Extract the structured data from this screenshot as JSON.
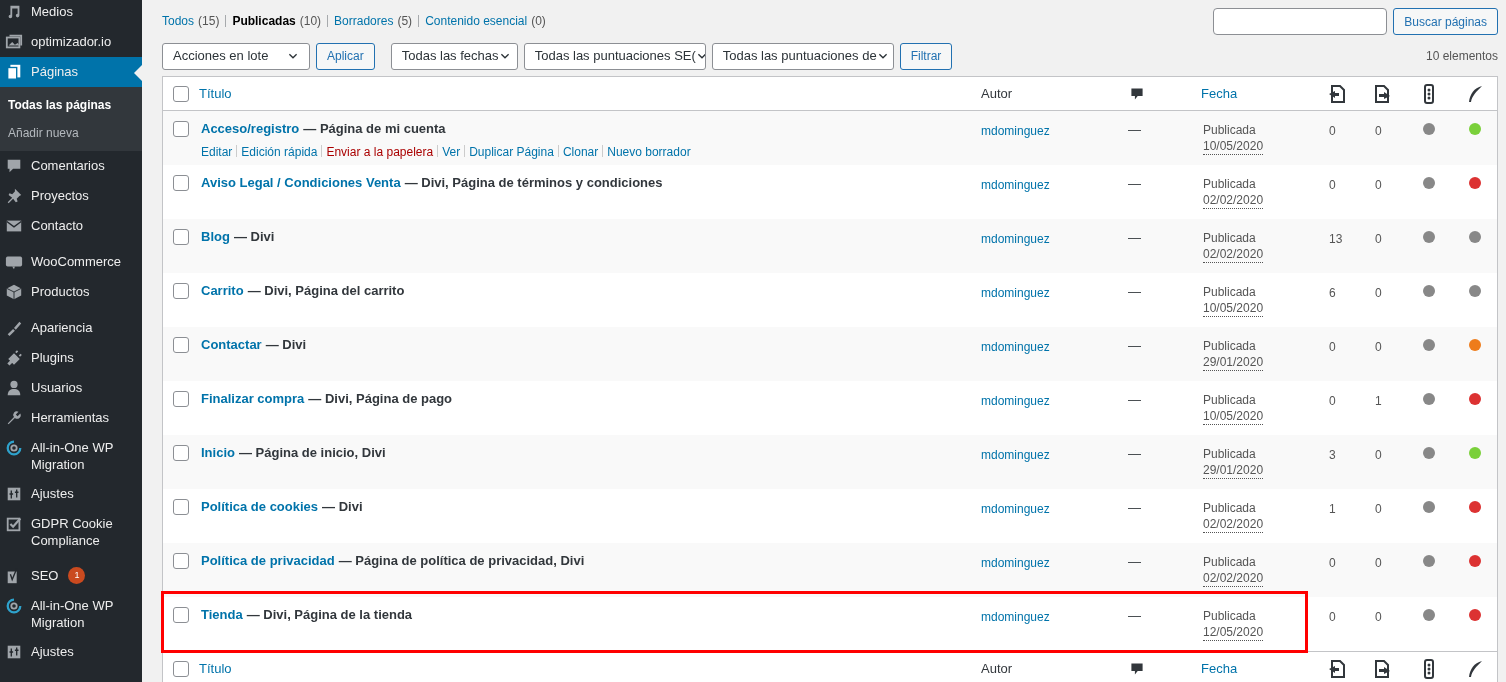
{
  "sidebar": {
    "items": [
      {
        "kind": "media",
        "label": "Medios",
        "selected": false
      },
      {
        "kind": "image",
        "label": "optimizador.io",
        "selected": false
      },
      {
        "kind": "pages",
        "label": "Páginas",
        "selected": true,
        "children": [
          {
            "label": "Todas las páginas",
            "selected": true
          },
          {
            "label": "Añadir nueva",
            "selected": false
          }
        ]
      },
      {
        "kind": "comment",
        "label": "Comentarios",
        "selected": false
      },
      {
        "kind": "pin",
        "label": "Proyectos",
        "selected": false
      },
      {
        "kind": "mail",
        "label": "Contacto",
        "selected": false
      },
      {
        "kind": "woo",
        "label": "WooCommerce",
        "selected": false
      },
      {
        "kind": "box",
        "label": "Productos",
        "selected": false
      },
      {
        "kind": "brush",
        "label": "Apariencia",
        "selected": false
      },
      {
        "kind": "plug",
        "label": "Plugins",
        "selected": false
      },
      {
        "kind": "user",
        "label": "Usuarios",
        "selected": false
      },
      {
        "kind": "wrench",
        "label": "Herramientas",
        "selected": false
      },
      {
        "kind": "migrate",
        "label": "All-in-One WP Migration",
        "selected": false
      },
      {
        "kind": "sliders",
        "label": "Ajustes",
        "selected": false
      },
      {
        "kind": "check",
        "label": "GDPR Cookie Compliance",
        "selected": false
      },
      {
        "kind": "yoast",
        "label": "SEO",
        "selected": false,
        "badge": "1"
      },
      {
        "kind": "migrate",
        "label": "All-in-One WP Migration",
        "selected": false
      },
      {
        "kind": "sliders",
        "label": "Ajustes",
        "selected": false
      }
    ]
  },
  "filters": [
    {
      "label": "Todos",
      "count": "(15)",
      "selected": false
    },
    {
      "label": "Publicadas",
      "count": "(10)",
      "selected": true
    },
    {
      "label": "Borradores",
      "count": "(5)",
      "selected": false
    },
    {
      "label": "Contenido esencial",
      "count": "(0)",
      "selected": false
    }
  ],
  "search": {
    "button": "Buscar páginas"
  },
  "bulk": {
    "select": "Acciones en lote",
    "apply": "Aplicar"
  },
  "dropdowns": [
    "Todas las fechas",
    "Todas las puntuaciones SE(",
    "Todas las puntuaciones de"
  ],
  "filter_button": "Filtrar",
  "count": "10 elementos",
  "header": {
    "checked": false,
    "title": "Título",
    "author": "Autor",
    "date": "Fecha"
  },
  "rows": [
    {
      "checked": false,
      "title": "Acceso/registro",
      "states": "— Página de mi cuenta",
      "author": "mdominguez",
      "comments": "—",
      "status": "Publicada",
      "date": "10/05/2020",
      "links_in": "0",
      "links_out": "0",
      "seo": {
        "color": "#888888"
      },
      "readability": {
        "color": "#7ad03a"
      },
      "highlighted": false,
      "actions": [
        {
          "label": "Editar",
          "kind": "link"
        },
        {
          "label": "Edición rápida",
          "kind": "link"
        },
        {
          "label": "Enviar a la papelera",
          "kind": "delete"
        },
        {
          "label": "Ver",
          "kind": "link"
        },
        {
          "label": "Duplicar Página",
          "kind": "link"
        },
        {
          "label": "Clonar",
          "kind": "link"
        },
        {
          "label": "Nuevo borrador",
          "kind": "link"
        }
      ]
    },
    {
      "checked": false,
      "title": "Aviso Legal / Condiciones Venta",
      "states": "— Divi, Página de términos y condiciones",
      "author": "mdominguez",
      "comments": "—",
      "status": "Publicada",
      "date": "02/02/2020",
      "links_in": "0",
      "links_out": "0",
      "seo": {
        "color": "#888888"
      },
      "readability": {
        "color": "#dc3232"
      },
      "highlighted": false
    },
    {
      "checked": false,
      "title": "Blog",
      "states": "— Divi",
      "author": "mdominguez",
      "comments": "—",
      "status": "Publicada",
      "date": "02/02/2020",
      "links_in": "13",
      "links_out": "0",
      "seo": {
        "color": "#888888"
      },
      "readability": {
        "color": "#888888"
      },
      "highlighted": false
    },
    {
      "checked": false,
      "title": "Carrito",
      "states": "— Divi, Página del carrito",
      "author": "mdominguez",
      "comments": "—",
      "status": "Publicada",
      "date": "10/05/2020",
      "links_in": "6",
      "links_out": "0",
      "seo": {
        "color": "#888888"
      },
      "readability": {
        "color": "#888888"
      },
      "highlighted": false
    },
    {
      "checked": false,
      "title": "Contactar",
      "states": "— Divi",
      "author": "mdominguez",
      "comments": "—",
      "status": "Publicada",
      "date": "29/01/2020",
      "links_in": "0",
      "links_out": "0",
      "seo": {
        "color": "#888888"
      },
      "readability": {
        "color": "#ee7c1b"
      },
      "highlighted": false
    },
    {
      "checked": false,
      "title": "Finalizar compra",
      "states": "— Divi, Página de pago",
      "author": "mdominguez",
      "comments": "—",
      "status": "Publicada",
      "date": "10/05/2020",
      "links_in": "0",
      "links_out": "1",
      "seo": {
        "color": "#888888"
      },
      "readability": {
        "color": "#dc3232"
      },
      "highlighted": false
    },
    {
      "checked": false,
      "title": "Inicio",
      "states": "— Página de inicio, Divi",
      "author": "mdominguez",
      "comments": "—",
      "status": "Publicada",
      "date": "29/01/2020",
      "links_in": "3",
      "links_out": "0",
      "seo": {
        "color": "#888888"
      },
      "readability": {
        "color": "#7ad03a"
      },
      "highlighted": false
    },
    {
      "checked": false,
      "title": "Política de cookies",
      "states": "— Divi",
      "author": "mdominguez",
      "comments": "—",
      "status": "Publicada",
      "date": "02/02/2020",
      "links_in": "1",
      "links_out": "0",
      "seo": {
        "color": "#888888"
      },
      "readability": {
        "color": "#dc3232"
      },
      "highlighted": false
    },
    {
      "checked": false,
      "title": "Política de privacidad",
      "states": "— Página de política de privacidad, Divi",
      "author": "mdominguez",
      "comments": "—",
      "status": "Publicada",
      "date": "02/02/2020",
      "links_in": "0",
      "links_out": "0",
      "seo": {
        "color": "#888888"
      },
      "readability": {
        "color": "#dc3232"
      },
      "highlighted": false
    },
    {
      "checked": false,
      "title": "Tienda",
      "states": "— Divi, Página de la tienda",
      "author": "mdominguez",
      "comments": "—",
      "status": "Publicada",
      "date": "12/05/2020",
      "links_in": "0",
      "links_out": "0",
      "seo": {
        "color": "#888888"
      },
      "readability": {
        "color": "#dc3232"
      },
      "highlighted": true
    }
  ],
  "footer": {
    "checked": false,
    "title": "Título",
    "author": "Autor",
    "date": "Fecha"
  }
}
